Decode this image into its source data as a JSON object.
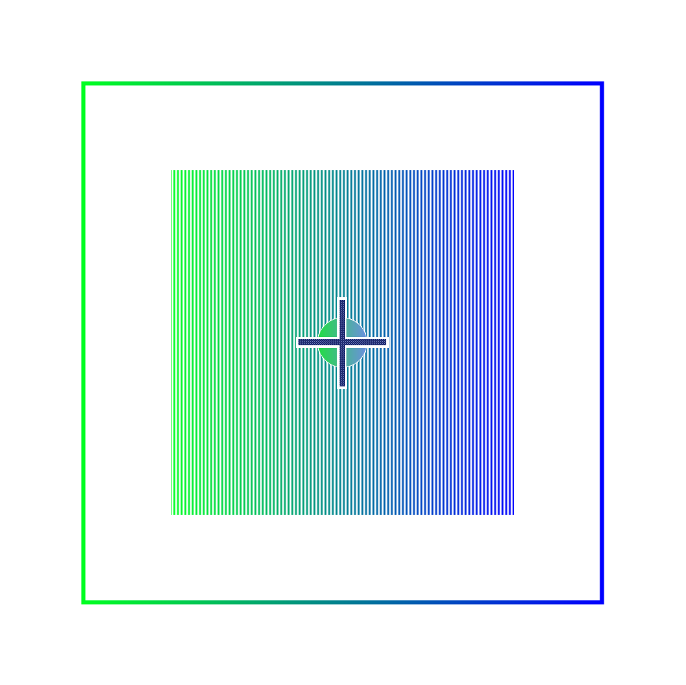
{
  "colors": {
    "background": "#ffffff",
    "gradient_start": "#00ff22",
    "gradient_end": "#0000ff",
    "crosshair_fill": "#1f2a6e",
    "crosshair_outline": "#ffffff",
    "disc_left": "#22dd44",
    "disc_right": "#6c8fe0"
  },
  "icons": {
    "crosshair": "crosshair-icon",
    "target_disc": "target-disc"
  }
}
